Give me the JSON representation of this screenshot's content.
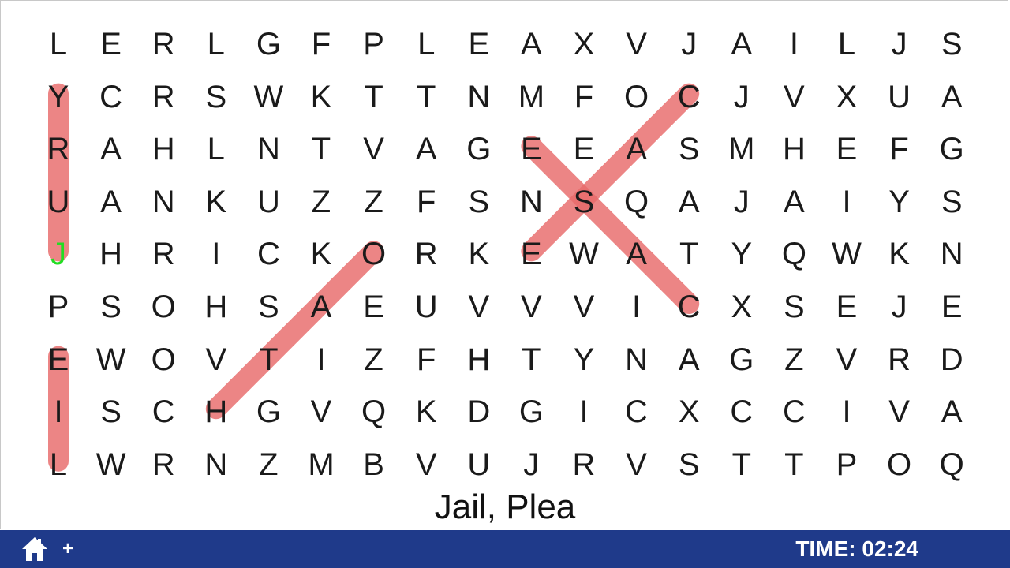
{
  "grid": [
    [
      "L",
      "E",
      "R",
      "L",
      "G",
      "F",
      "P",
      "L",
      "E",
      "A",
      "X",
      "V",
      "J",
      "A",
      "I",
      "L",
      "J",
      "S"
    ],
    [
      "Y",
      "C",
      "R",
      "S",
      "W",
      "K",
      "T",
      "T",
      "N",
      "M",
      "F",
      "O",
      "C",
      "J",
      "V",
      "X",
      "U",
      "A"
    ],
    [
      "R",
      "A",
      "H",
      "L",
      "N",
      "T",
      "V",
      "A",
      "G",
      "E",
      "E",
      "A",
      "S",
      "M",
      "H",
      "E",
      "F",
      "G"
    ],
    [
      "U",
      "A",
      "N",
      "K",
      "U",
      "Z",
      "Z",
      "F",
      "S",
      "N",
      "S",
      "Q",
      "A",
      "J",
      "A",
      "I",
      "Y",
      "S"
    ],
    [
      "J",
      "H",
      "R",
      "I",
      "C",
      "K",
      "O",
      "R",
      "K",
      "E",
      "W",
      "A",
      "T",
      "Y",
      "Q",
      "W",
      "K",
      "N"
    ],
    [
      "P",
      "S",
      "O",
      "H",
      "S",
      "A",
      "E",
      "U",
      "V",
      "V",
      "V",
      "I",
      "C",
      "X",
      "S",
      "E",
      "J",
      "E"
    ],
    [
      "E",
      "W",
      "O",
      "V",
      "T",
      "I",
      "Z",
      "F",
      "H",
      "T",
      "Y",
      "N",
      "A",
      "G",
      "Z",
      "V",
      "R",
      "D"
    ],
    [
      "I",
      "S",
      "C",
      "H",
      "G",
      "V",
      "Q",
      "K",
      "D",
      "G",
      "I",
      "C",
      "X",
      "C",
      "C",
      "I",
      "V",
      "A"
    ],
    [
      "L",
      "W",
      "R",
      "N",
      "Z",
      "M",
      "B",
      "V",
      "U",
      "J",
      "R",
      "V",
      "S",
      "T",
      "T",
      "P",
      "O",
      "Q"
    ]
  ],
  "hint_cell": {
    "row": 4,
    "col": 0
  },
  "found_words": [
    {
      "from": [
        1,
        0
      ],
      "to": [
        4,
        0
      ]
    },
    {
      "from": [
        6,
        0
      ],
      "to": [
        8,
        0
      ]
    },
    {
      "from": [
        7,
        3
      ],
      "to": [
        4,
        6
      ]
    },
    {
      "from": [
        1,
        12
      ],
      "to": [
        4,
        9
      ]
    },
    {
      "from": [
        2,
        9
      ],
      "to": [
        5,
        12
      ]
    }
  ],
  "highlight_color": "#e86a6a",
  "word_list": "Jail, Plea",
  "bottom_bar": {
    "timer": "TIME: 02:24",
    "plus_label": "+",
    "home_icon": "home-icon",
    "color": "#1f3a8a"
  }
}
